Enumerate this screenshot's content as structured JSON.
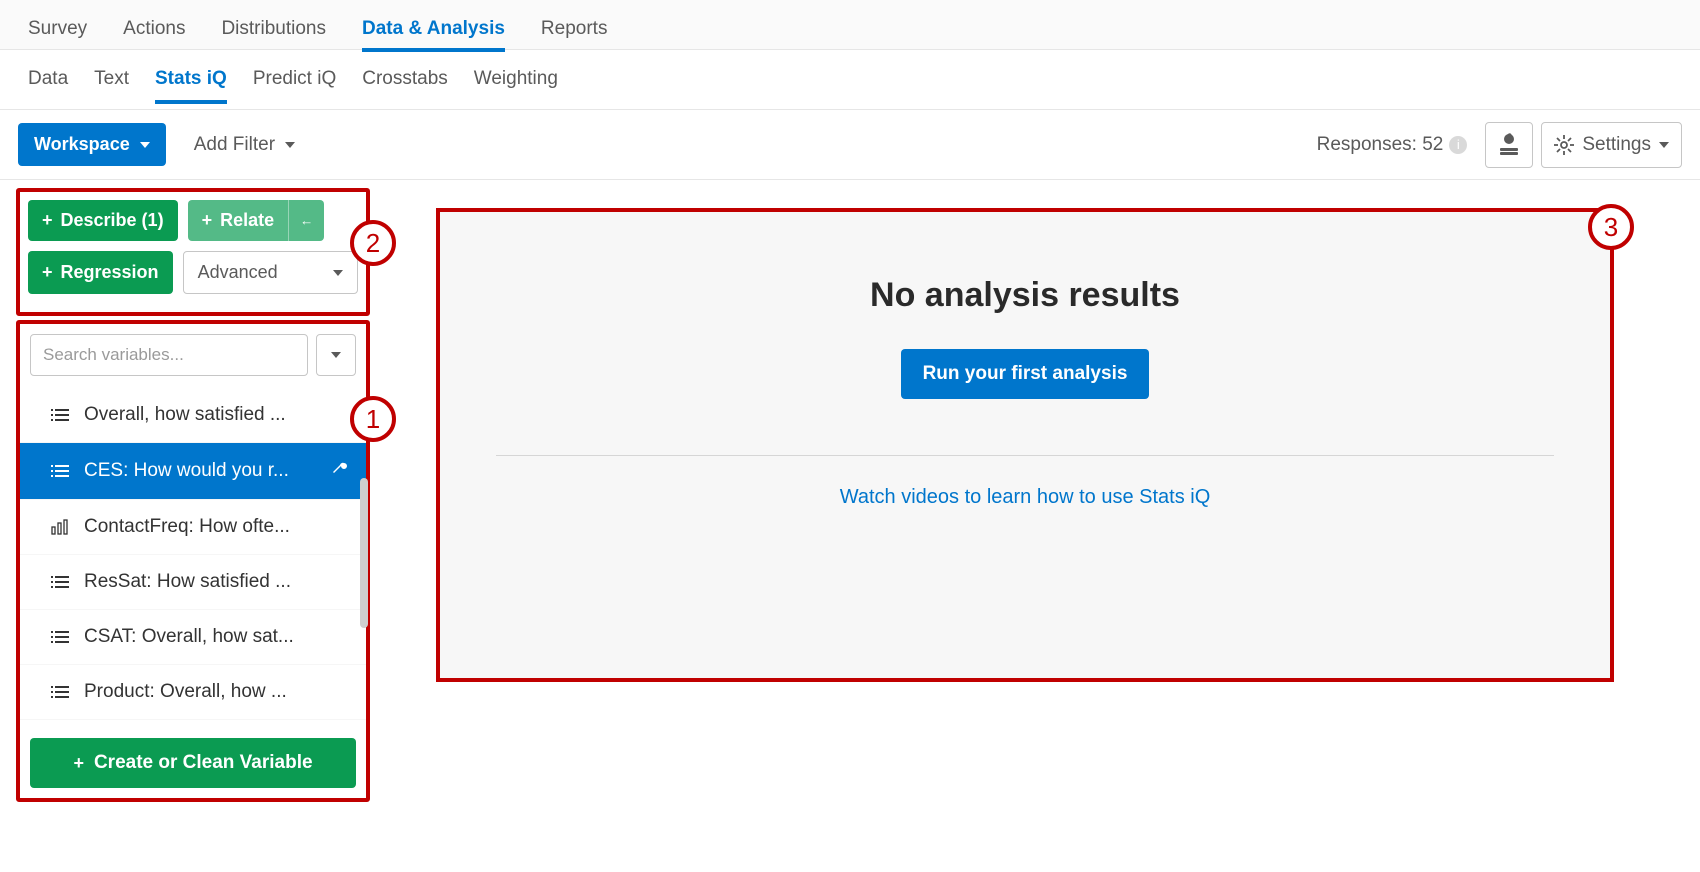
{
  "toptabs": {
    "t0": "Survey",
    "t1": "Actions",
    "t2": "Distributions",
    "t3": "Data & Analysis",
    "t4": "Reports",
    "active": "t3"
  },
  "subtabs": {
    "s0": "Data",
    "s1": "Text",
    "s2": "Stats iQ",
    "s3": "Predict iQ",
    "s4": "Crosstabs",
    "s5": "Weighting",
    "active": "s2"
  },
  "toolbar": {
    "workspace": "Workspace",
    "add_filter": "Add Filter",
    "responses_label": "Responses: 52",
    "settings": "Settings"
  },
  "analysis": {
    "describe": "Describe (1)",
    "relate": "Relate",
    "regression": "Regression",
    "advanced": "Advanced"
  },
  "search": {
    "placeholder": "Search variables..."
  },
  "variables": {
    "v0": "Overall, how satisfied ...",
    "v1": "CES: How would you r...",
    "v2": "ContactFreq: How ofte...",
    "v3": "ResSat: How satisfied ...",
    "v4": "CSAT: Overall, how sat...",
    "v5": "Product: Overall, how ..."
  },
  "create_variable": "Create or Clean Variable",
  "main": {
    "title": "No analysis results",
    "run": "Run your first analysis",
    "video": "Watch videos to learn how to use Stats iQ"
  },
  "callouts": {
    "c1": "1",
    "c2": "2",
    "c3": "3"
  }
}
